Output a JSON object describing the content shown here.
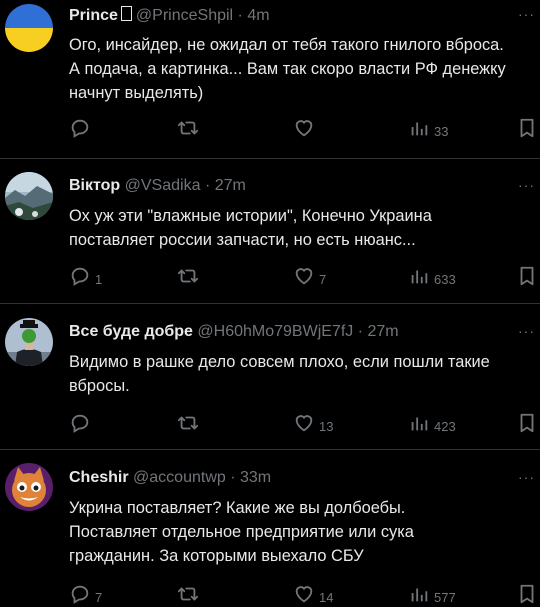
{
  "tweets": [
    {
      "name": "Prince",
      "handle": "@PrinceShpil",
      "dot": "·",
      "time": "4m",
      "text": "Ого, инсайдер, не ожидал от тебя такого гнилого вброса. А подача, а картинка... Вам так скоро власти РФ денежку начнут выделять)",
      "reply_count": "",
      "like_count": "",
      "view_count": "33",
      "avatar_icon": "ukraine-flag-avatar"
    },
    {
      "name": "Віктор",
      "handle": "@VSadika",
      "dot": "·",
      "time": "27m",
      "text": "Ох уж эти \"влажные истории\", Конечно Украина поставляет россии запчасти, но есть нюанс...",
      "reply_count": "1",
      "like_count": "7",
      "view_count": "633",
      "avatar_icon": "landscape-avatar"
    },
    {
      "name": "Все буде добре",
      "handle": "@H60hMo79BWjE7fJ",
      "dot": "·",
      "time": "27m",
      "text": "Видимо в рашке дело совсем плохо, если пошли такие вбросы.",
      "reply_count": "",
      "like_count": "13",
      "view_count": "423",
      "avatar_icon": "man-apple-avatar"
    },
    {
      "name": "Cheshir",
      "handle": "@accountwp",
      "dot": "·",
      "time": "33m",
      "text": "Укрина поставляет? Какие же вы долбоебы.\nПоставляет отдельное предприятие или сука\nгражданин. За которыми выехало СБУ",
      "reply_count": "7",
      "like_count": "14",
      "view_count": "577",
      "avatar_icon": "cartoon-cat-avatar"
    }
  ],
  "more_label": "···",
  "colors": {
    "background": "#000000",
    "text": "#e7e9ea",
    "secondary": "#71767b",
    "separator": "#2f3336"
  }
}
